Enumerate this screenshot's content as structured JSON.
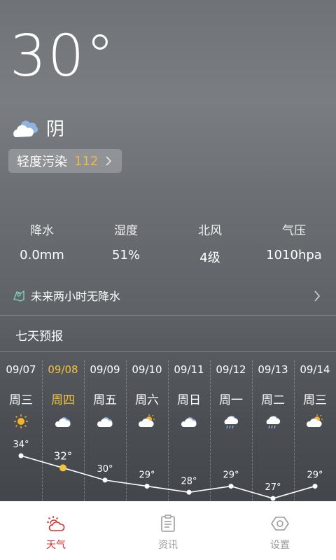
{
  "current": {
    "temperature": "30°",
    "condition": "阴",
    "condition_icon": "cloudy-icon",
    "aqi_label": "轻度污染",
    "aqi_value": "112",
    "aqi_color": "#e8b84a"
  },
  "metrics": [
    {
      "label": "降水",
      "value": "0.0mm"
    },
    {
      "label": "湿度",
      "value": "51%"
    },
    {
      "label": "北风",
      "value": "4级"
    },
    {
      "label": "气压",
      "value": "1010hpa"
    }
  ],
  "rain_notice": "未来两小时无降水",
  "forecast_title": "七天预报",
  "forecast": [
    {
      "date": "09/07",
      "weekday": "周三",
      "icon": "sunny-icon",
      "high": 34,
      "high_label": "34°",
      "active": false
    },
    {
      "date": "09/08",
      "weekday": "周四",
      "icon": "cloudy-icon",
      "high": 32,
      "high_label": "32°",
      "active": true
    },
    {
      "date": "09/09",
      "weekday": "周五",
      "icon": "cloudy-icon",
      "high": 30,
      "high_label": "30°",
      "active": false
    },
    {
      "date": "09/10",
      "weekday": "周六",
      "icon": "partly-cloudy-icon",
      "high": 29,
      "high_label": "29°",
      "active": false
    },
    {
      "date": "09/11",
      "weekday": "周日",
      "icon": "cloudy-icon",
      "high": 28,
      "high_label": "28°",
      "active": false
    },
    {
      "date": "09/12",
      "weekday": "周一",
      "icon": "rain-icon",
      "high": 29,
      "high_label": "29°",
      "active": false
    },
    {
      "date": "09/13",
      "weekday": "周二",
      "icon": "rain-icon",
      "high": 27,
      "high_label": "27°",
      "active": false
    },
    {
      "date": "09/14",
      "weekday": "周三",
      "icon": "partly-cloudy-icon",
      "high": 29,
      "high_label": "29°",
      "active": false
    }
  ],
  "tabs": [
    {
      "label": "天气",
      "icon": "weather-icon",
      "active": true
    },
    {
      "label": "资讯",
      "icon": "news-icon",
      "active": false
    },
    {
      "label": "设置",
      "icon": "settings-icon",
      "active": false
    }
  ],
  "colors": {
    "accent_yellow": "#f2c33d",
    "tab_active": "#d8302c",
    "tab_inactive": "#9a9a9a"
  }
}
